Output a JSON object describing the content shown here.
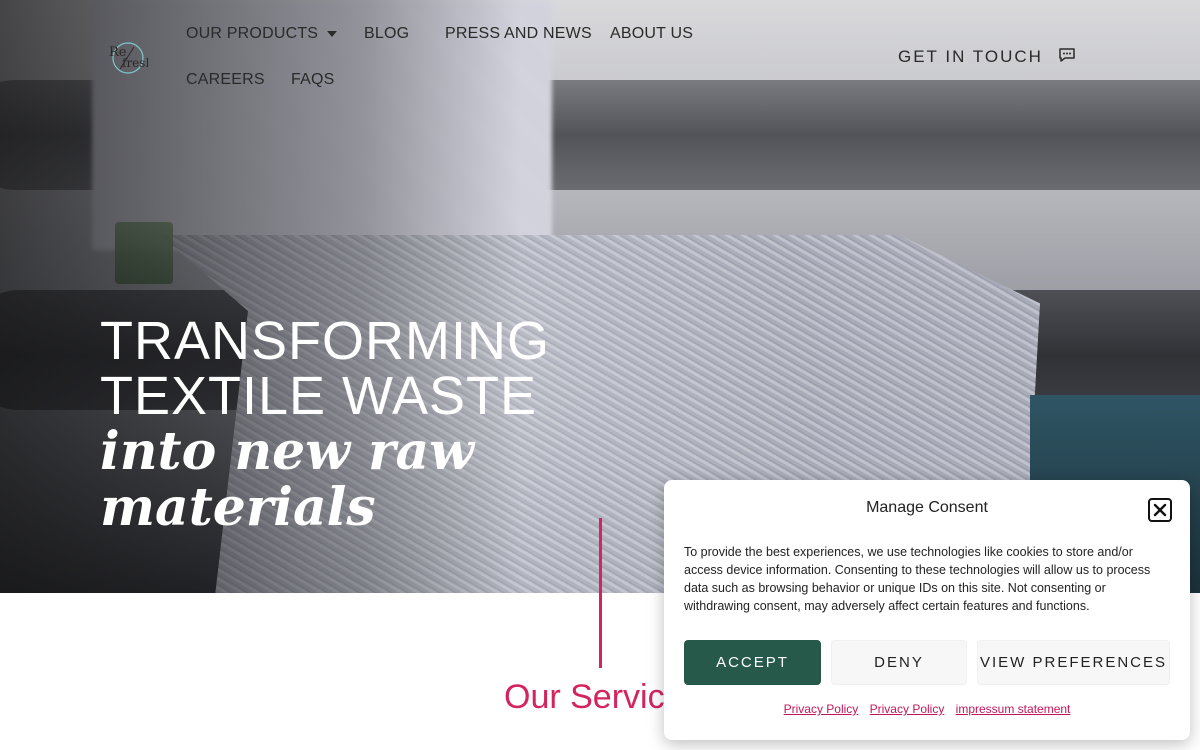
{
  "nav": {
    "logo_text": "Refresh",
    "products_label": "OUR PRODUCTS",
    "blog_label": "BLOG",
    "press_label": "PRESS AND NEWS",
    "about_label": "ABOUT US",
    "careers_label": "CAREERS",
    "faqs_label": "FAQS",
    "cta_label": "GET IN TOUCH",
    "cta_icon": "chat-bubble-icon",
    "products_icon": "caret-down-icon"
  },
  "hero": {
    "line1": "TRANSFORMING",
    "line2": "TEXTILE WASTE",
    "line3": "into new raw",
    "line4": "materials"
  },
  "services": {
    "title": "Our Services"
  },
  "consent": {
    "title": "Manage Consent",
    "close_icon": "close-icon",
    "body": "To provide the best experiences, we use technologies like cookies to store and/or access device information. Consenting to these technologies will allow us to process data such as browsing behavior or unique IDs on this site. Not consenting or withdrawing consent, may adversely affect certain features and functions.",
    "accept_label": "ACCEPT",
    "deny_label": "DENY",
    "preferences_label": "VIEW PREFERENCES",
    "links": [
      "Privacy Policy",
      "Privacy Policy",
      "impressum statement"
    ]
  },
  "colors": {
    "accent_pink": "#d4245d",
    "accept_green": "#27594a",
    "link_pink": "#c2185b"
  }
}
